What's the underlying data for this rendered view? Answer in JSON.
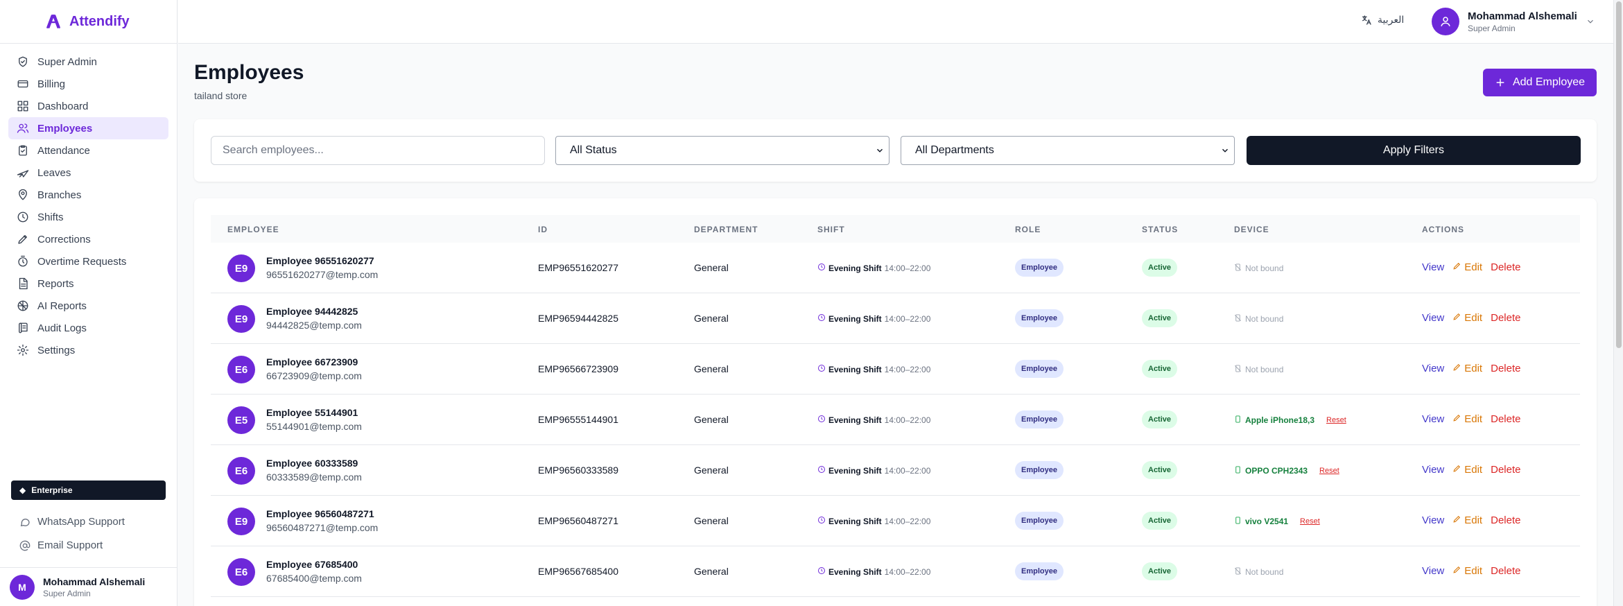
{
  "app": {
    "name": "Attendify"
  },
  "sidebar": {
    "items": [
      {
        "label": "Super Admin",
        "icon": "shield-icon"
      },
      {
        "label": "Billing",
        "icon": "credit-card-icon"
      },
      {
        "label": "Dashboard",
        "icon": "dashboard-icon"
      },
      {
        "label": "Employees",
        "icon": "users-icon",
        "active": true
      },
      {
        "label": "Attendance",
        "icon": "clipboard-check-icon"
      },
      {
        "label": "Leaves",
        "icon": "plane-icon"
      },
      {
        "label": "Branches",
        "icon": "map-pin-icon"
      },
      {
        "label": "Shifts",
        "icon": "clock-icon"
      },
      {
        "label": "Corrections",
        "icon": "pencil-icon"
      },
      {
        "label": "Overtime Requests",
        "icon": "timer-icon"
      },
      {
        "label": "Reports",
        "icon": "file-text-icon"
      },
      {
        "label": "AI Reports",
        "icon": "brain-icon"
      },
      {
        "label": "Audit Logs",
        "icon": "scroll-icon"
      },
      {
        "label": "Settings",
        "icon": "gear-icon"
      }
    ],
    "plan": "Enterprise",
    "whatsapp_support": "WhatsApp Support",
    "email_support": "Email Support",
    "user": {
      "initial": "M",
      "name": "Mohammad Alshemali",
      "role": "Super Admin"
    }
  },
  "topbar": {
    "language": "العربية",
    "user": {
      "name": "Mohammad Alshemali",
      "role": "Super Admin"
    }
  },
  "page": {
    "title": "Employees",
    "subtitle": "tailand store",
    "add_button": "Add Employee"
  },
  "filters": {
    "search_placeholder": "Search employees...",
    "status": "All Status",
    "department": "All Departments",
    "apply": "Apply Filters"
  },
  "table": {
    "columns": [
      "EMPLOYEE",
      "ID",
      "DEPARTMENT",
      "SHIFT",
      "ROLE",
      "STATUS",
      "DEVICE",
      "ACTIONS"
    ],
    "action_labels": {
      "view": "View",
      "edit": "Edit",
      "delete": "Delete",
      "reset": "Reset"
    },
    "rows": [
      {
        "initials": "E9",
        "name": "Employee 96551620277",
        "email": "96551620277@temp.com",
        "id": "EMP96551620277",
        "department": "General",
        "shift": "Evening Shift",
        "shift_time": "14:00–22:00",
        "role": "Employee",
        "status": "Active",
        "device": "Not bound",
        "bound": false
      },
      {
        "initials": "E9",
        "name": "Employee 94442825",
        "email": "94442825@temp.com",
        "id": "EMP96594442825",
        "department": "General",
        "shift": "Evening Shift",
        "shift_time": "14:00–22:00",
        "role": "Employee",
        "status": "Active",
        "device": "Not bound",
        "bound": false
      },
      {
        "initials": "E6",
        "name": "Employee 66723909",
        "email": "66723909@temp.com",
        "id": "EMP96566723909",
        "department": "General",
        "shift": "Evening Shift",
        "shift_time": "14:00–22:00",
        "role": "Employee",
        "status": "Active",
        "device": "Not bound",
        "bound": false
      },
      {
        "initials": "E5",
        "name": "Employee 55144901",
        "email": "55144901@temp.com",
        "id": "EMP96555144901",
        "department": "General",
        "shift": "Evening Shift",
        "shift_time": "14:00–22:00",
        "role": "Employee",
        "status": "Active",
        "device": "Apple iPhone18,3",
        "bound": true
      },
      {
        "initials": "E6",
        "name": "Employee 60333589",
        "email": "60333589@temp.com",
        "id": "EMP96560333589",
        "department": "General",
        "shift": "Evening Shift",
        "shift_time": "14:00–22:00",
        "role": "Employee",
        "status": "Active",
        "device": "OPPO CPH2343",
        "bound": true
      },
      {
        "initials": "E9",
        "name": "Employee 96560487271",
        "email": "96560487271@temp.com",
        "id": "EMP96560487271",
        "department": "General",
        "shift": "Evening Shift",
        "shift_time": "14:00–22:00",
        "role": "Employee",
        "status": "Active",
        "device": "vivo V2541",
        "bound": true
      },
      {
        "initials": "E6",
        "name": "Employee 67685400",
        "email": "67685400@temp.com",
        "id": "EMP96567685400",
        "department": "General",
        "shift": "Evening Shift",
        "shift_time": "14:00–22:00",
        "role": "Employee",
        "status": "Active",
        "device": "Not bound",
        "bound": false
      }
    ]
  },
  "colors": {
    "brand": "#6d28d9",
    "dark": "#111827",
    "success": "#166534",
    "danger": "#dc2626",
    "warning": "#d97706"
  }
}
